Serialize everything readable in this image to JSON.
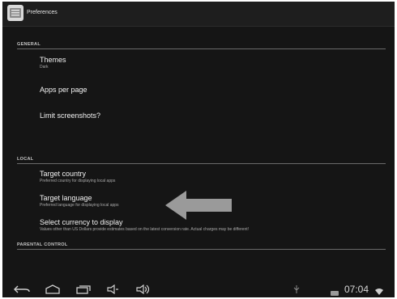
{
  "titlebar": {
    "title": "Preferences",
    "icon": "app-settings-icon"
  },
  "sections": {
    "general": {
      "header": "GENERAL",
      "items": [
        {
          "title": "Themes",
          "summary": "Dark"
        },
        {
          "title": "Apps per page",
          "summary": ""
        },
        {
          "title": "Limit screenshots?",
          "summary": ""
        }
      ]
    },
    "local": {
      "header": "LOCAL",
      "items": [
        {
          "title": "Target country",
          "summary": "Preferred country for displaying local apps"
        },
        {
          "title": "Target language",
          "summary": "Preferred language for displaying local apps"
        },
        {
          "title": "Select currency to display",
          "summary": "Values other than US Dollars provide estimates based on the latest conversion rate. Actual charges may be different!"
        }
      ]
    },
    "parental": {
      "header": "PARENTAL CONTROL"
    }
  },
  "annotation": {
    "icon": "pointer-arrow-icon",
    "color": "#9a9a9a"
  },
  "navbar": {
    "icons": [
      "back-icon",
      "home-icon",
      "recent-apps-icon",
      "volume-down-icon",
      "volume-up-icon"
    ],
    "status_icons": [
      "usb-icon",
      "notification-icon",
      "wifi-icon"
    ],
    "time": "07:04"
  }
}
